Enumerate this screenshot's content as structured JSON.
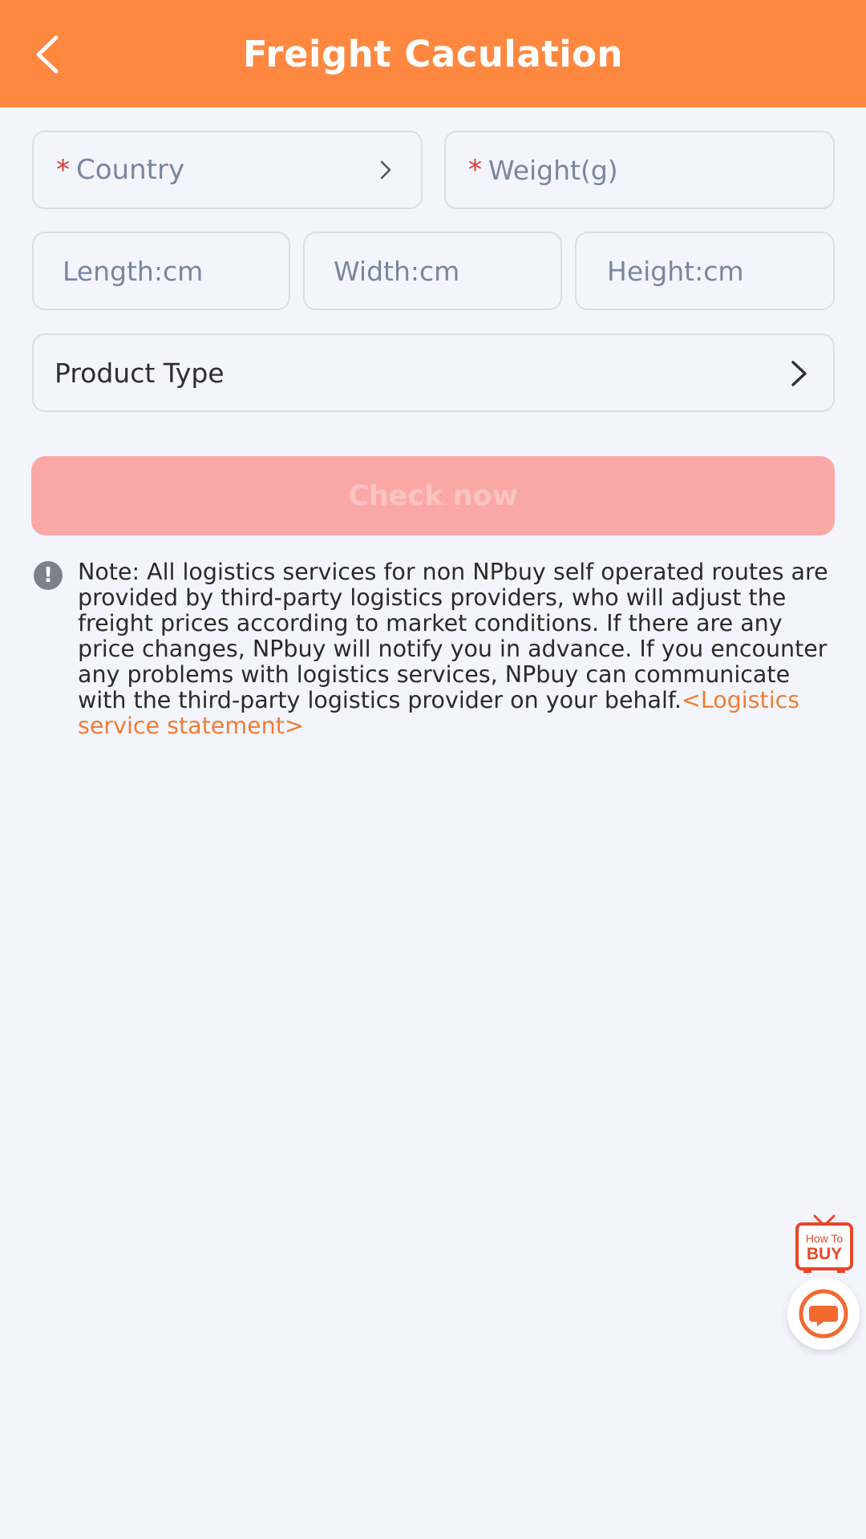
{
  "header": {
    "title": "Freight Caculation"
  },
  "form": {
    "country": {
      "required_mark": "*",
      "placeholder": "Country"
    },
    "weight": {
      "required_mark": "*",
      "placeholder": "Weight(g)"
    },
    "length": {
      "placeholder": "Length:cm"
    },
    "width": {
      "placeholder": "Width:cm"
    },
    "height": {
      "placeholder": "Height:cm"
    },
    "product_type": {
      "label": "Product Type"
    },
    "submit_label": "Check now"
  },
  "note": {
    "text": "Note: All logistics services for non NPbuy self operated routes are provided by third-party logistics providers, who will adjust the freight prices according to market conditions. If there are any price changes, NPbuy will notify you in advance. If you encounter any problems with logistics services, NPbuy can communicate with the third-party logistics provider on your behalf.",
    "link": "<Logistics service statement>"
  },
  "widgets": {
    "how_to_buy_top": "How To",
    "how_to_buy_bottom": "BUY"
  },
  "colors": {
    "header": "#ff8840",
    "accent": "#ef7d34",
    "required": "#d43b2e",
    "button_disabled": "#faa8a6"
  }
}
